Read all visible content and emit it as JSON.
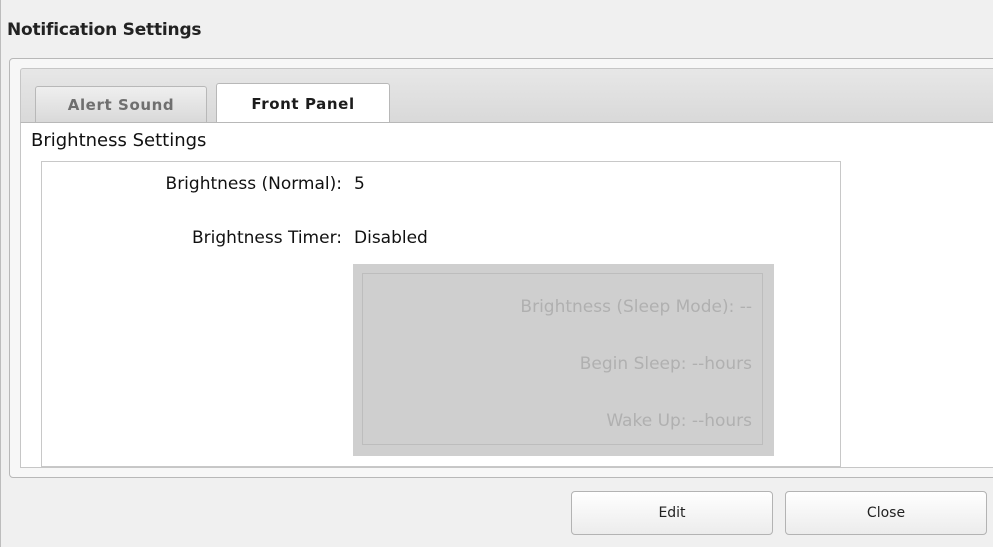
{
  "window": {
    "title": "Notification Settings"
  },
  "tabs": [
    {
      "label": "Alert Sound",
      "active": false
    },
    {
      "label": "Front Panel",
      "active": true
    }
  ],
  "brightness": {
    "section_title": "Brightness Settings",
    "normal_label": "Brightness (Normal):",
    "normal_value": "5",
    "timer_label": "Brightness Timer:",
    "timer_value": "Disabled"
  },
  "sleep": {
    "sleep_mode": "Brightness (Sleep Mode): --",
    "begin_sleep": "Begin Sleep: --hours",
    "wake_up": "Wake Up: --hours"
  },
  "buttons": {
    "edit": "Edit",
    "close": "Close"
  }
}
